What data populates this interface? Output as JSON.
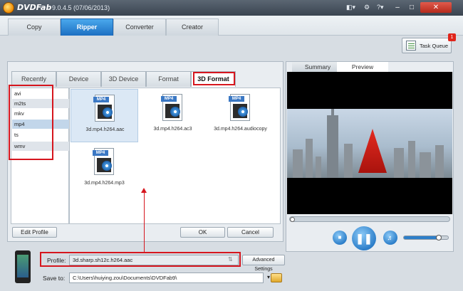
{
  "app": {
    "brand": "DVDFab",
    "version": "9.0.4.5 (07/06/2013)"
  },
  "main_tabs": [
    {
      "label": "Copy"
    },
    {
      "label": "Ripper"
    },
    {
      "label": "Converter"
    },
    {
      "label": "Creator"
    }
  ],
  "task_queue": {
    "label": "Task Queue",
    "badge": "1"
  },
  "format_tabs": [
    {
      "label": "Recently"
    },
    {
      "label": "Device"
    },
    {
      "label": "3D Device"
    },
    {
      "label": "Format"
    },
    {
      "label": "3D Format"
    }
  ],
  "format_list": [
    "avi",
    "m2ts",
    "mkv",
    "mp4",
    "ts",
    "wmv"
  ],
  "profiles": [
    {
      "tag": "MP4",
      "name": "3d.mp4.h264.aac"
    },
    {
      "tag": "MP4",
      "name": "3d.mp4.h264.ac3"
    },
    {
      "tag": "MP4",
      "name": "3d.mp4.h264.audiocopy"
    },
    {
      "tag": "MP4",
      "name": "3d.mp4.h264.mp3"
    }
  ],
  "buttons": {
    "edit_profile": "Edit Profile",
    "ok": "OK",
    "cancel": "Cancel",
    "advanced_settings": "Advanced Settings"
  },
  "preview_tabs": [
    {
      "label": "Summary"
    },
    {
      "label": "Preview"
    }
  ],
  "profile": {
    "label": "Profile:",
    "value": "3d.sharp.sh12c.h264.aac"
  },
  "save_to": {
    "label": "Save to:",
    "value": "C:\\Users\\huiying.zou\\Documents\\DVDFab9\\"
  },
  "colors": {
    "accent": "#1c6fc2",
    "highlight": "#d6161e"
  }
}
